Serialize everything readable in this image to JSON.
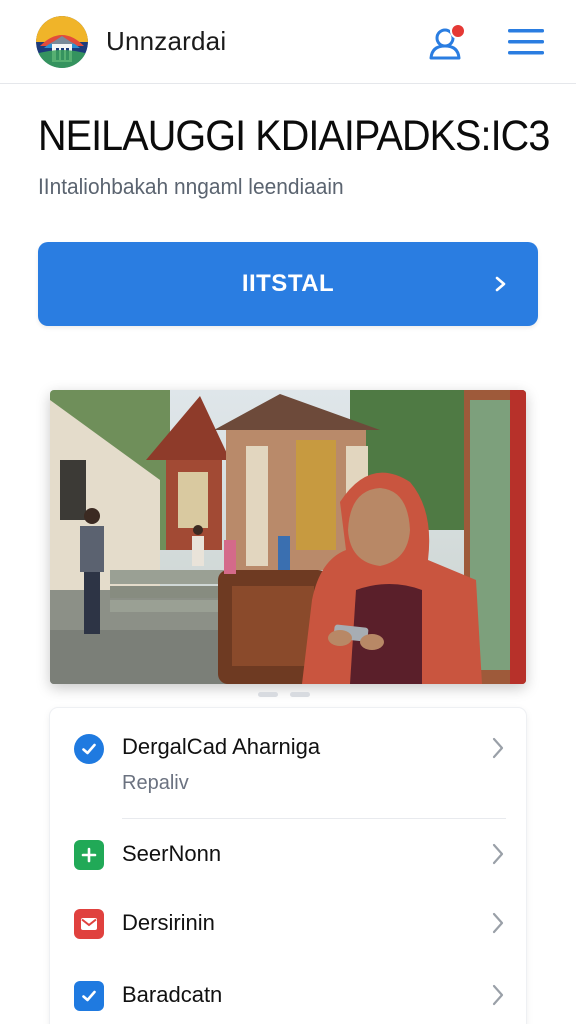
{
  "header": {
    "app_name": "Unnzardai",
    "logo_icon": "mosque-logo-icon",
    "notification_icon": "user-bell-icon",
    "menu_icon": "hamburger-menu-icon"
  },
  "main": {
    "headline": "NEILAUGGI KDIAIPADKS:IC3",
    "subtitle": "IIntaliohbakah nngaml leendiaain",
    "cta_label": "IITSTAL"
  },
  "list": {
    "items": [
      {
        "title": "DergalCad Aharniga",
        "subtitle": "Repaliv",
        "icon": "check-circle-icon",
        "color": "#1f7ae0"
      },
      {
        "title": "SeerNonn",
        "subtitle": "",
        "icon": "plus-square-icon",
        "color": "#21a957"
      },
      {
        "title": "Dersirinin",
        "subtitle": "",
        "icon": "mail-icon",
        "color": "#e0413e"
      },
      {
        "title": "Baradcatn",
        "subtitle": "",
        "icon": "check-square-icon",
        "color": "#1f7ae0"
      }
    ]
  },
  "colors": {
    "accent": "#2a7de1",
    "notif_dot": "#e53935"
  }
}
